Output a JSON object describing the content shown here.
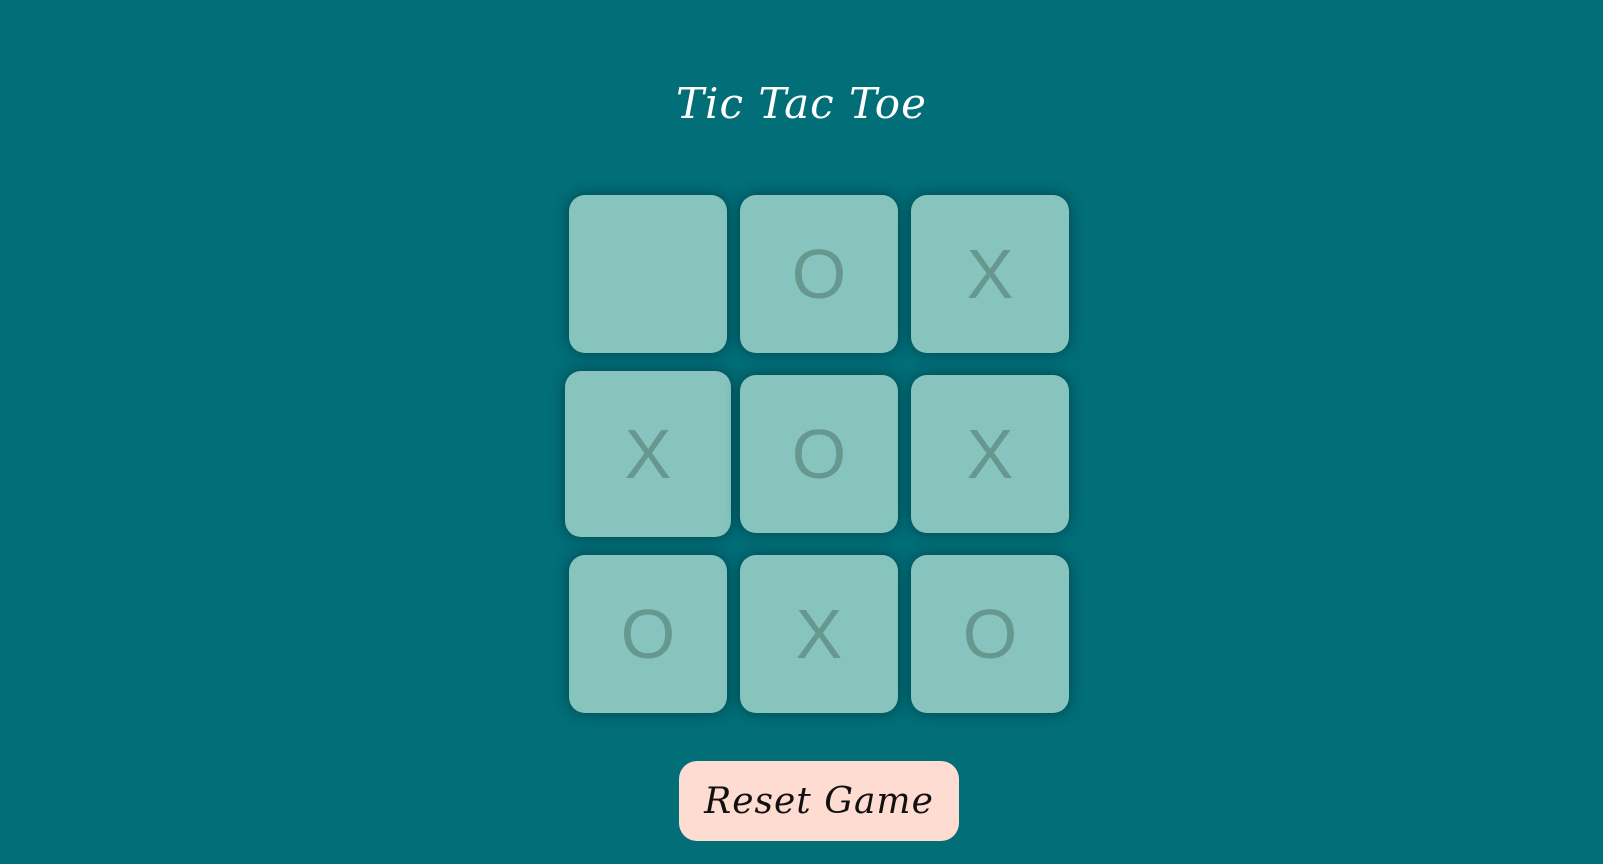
{
  "title": "Tic Tac Toe",
  "board": {
    "cells": [
      "",
      "O",
      "X",
      "X",
      "O",
      "X",
      "O",
      "X",
      "O"
    ]
  },
  "reset_label": "Reset Game",
  "colors": {
    "background": "#026e78",
    "cell": "#87c4bd",
    "mark": "#67988f",
    "button": "#fedcd2"
  }
}
